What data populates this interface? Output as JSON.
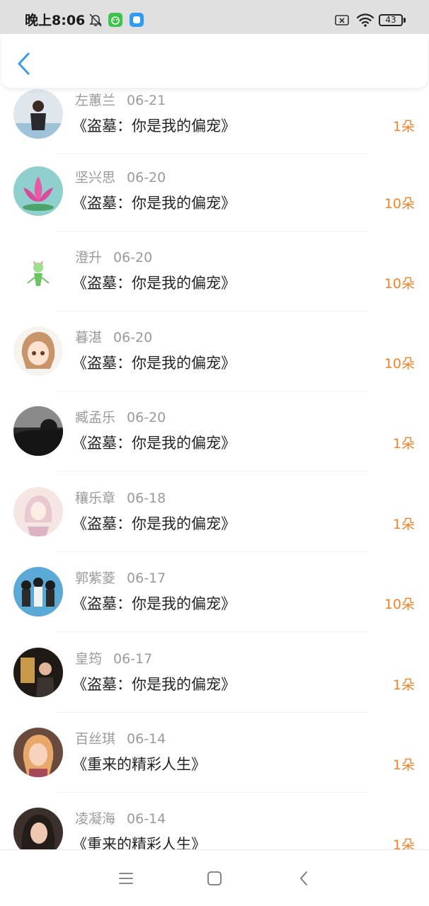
{
  "status_bar": {
    "time": "晚上8:06",
    "battery": "43",
    "icons": [
      "bell-off-icon",
      "green-app-icon",
      "blue-app-icon",
      "sim-off-icon",
      "wifi-icon",
      "battery-icon"
    ]
  },
  "header": {
    "back_icon": "chevron-left-icon"
  },
  "colors": {
    "accent": "#3a9be8",
    "amount": "#f0842c",
    "meta": "#9a9a9a",
    "title": "#222222"
  },
  "list": [
    {
      "user": "左蕙兰",
      "date": "06-21",
      "book": "《盗墓：你是我的偏宠》",
      "amount": "1朵"
    },
    {
      "user": "坚兴思",
      "date": "06-20",
      "book": "《盗墓：你是我的偏宠》",
      "amount": "10朵"
    },
    {
      "user": "澄升",
      "date": "06-20",
      "book": "《盗墓：你是我的偏宠》",
      "amount": "10朵"
    },
    {
      "user": "暮湛",
      "date": "06-20",
      "book": "《盗墓：你是我的偏宠》",
      "amount": "10朵"
    },
    {
      "user": "臧孟乐",
      "date": "06-20",
      "book": "《盗墓：你是我的偏宠》",
      "amount": "1朵"
    },
    {
      "user": "穰乐章",
      "date": "06-18",
      "book": "《盗墓：你是我的偏宠》",
      "amount": "1朵"
    },
    {
      "user": "郭紫菱",
      "date": "06-17",
      "book": "《盗墓：你是我的偏宠》",
      "amount": "10朵"
    },
    {
      "user": "皇筠",
      "date": "06-17",
      "book": "《盗墓：你是我的偏宠》",
      "amount": "1朵"
    },
    {
      "user": "百丝琪",
      "date": "06-14",
      "book": "《重来的精彩人生》",
      "amount": "1朵"
    },
    {
      "user": "凌凝海",
      "date": "06-14",
      "book": "《重来的精彩人生》",
      "amount": "1朵"
    }
  ],
  "system_nav": [
    "menu-icon",
    "home-square-icon",
    "back-triangle-icon"
  ]
}
